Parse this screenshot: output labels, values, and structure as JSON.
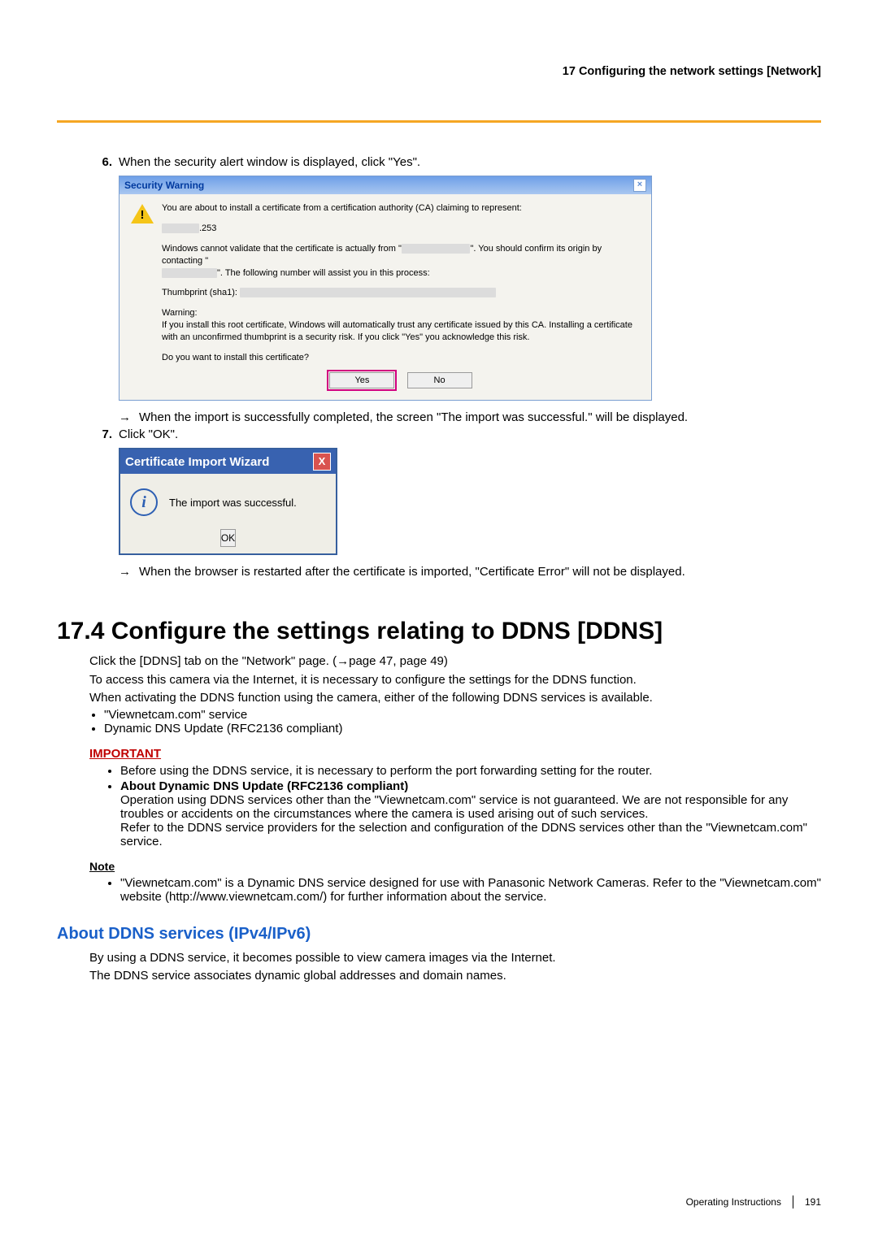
{
  "header": {
    "title": "17 Configuring the network settings [Network]"
  },
  "step6": {
    "num": "6.",
    "text": "When the security alert window is displayed, click \"Yes\"."
  },
  "security_dialog": {
    "title": "Security Warning",
    "line1": "You are about to install a certificate from a certification authority (CA) claiming to represent:",
    "masked1": ".253",
    "line2a": "Windows cannot validate that the certificate is actually from \"",
    "line2b": "\". You should confirm its origin by contacting \"",
    "line2c": "\". The following number will assist you in this process:",
    "thumb_label": "Thumbprint (sha1): ",
    "warning_label": "Warning:",
    "warning_text": "If you install this root certificate, Windows will automatically trust any certificate issued by this CA. Installing a certificate with an unconfirmed thumbprint is a security risk. If you click \"Yes\" you acknowledge this risk.",
    "question": "Do you want to install this certificate?",
    "yes": "Yes",
    "no": "No"
  },
  "arrow1": "When the import is successfully completed, the screen \"The import was successful.\" will be displayed.",
  "step7": {
    "num": "7.",
    "text": "Click \"OK\"."
  },
  "import_dialog": {
    "title": "Certificate Import Wizard",
    "message": "The import was successful.",
    "ok": "OK"
  },
  "arrow2": "When the browser is restarted after the certificate is imported, \"Certificate Error\" will not be displayed.",
  "section": {
    "heading": "17.4  Configure the settings relating to DDNS [DDNS]",
    "p1": "Click the [DDNS] tab on the \"Network\" page. (→page 47, page 49)",
    "p2": "To access this camera via the Internet, it is necessary to configure the settings for the DDNS function.",
    "p3": "When activating the DDNS function using the camera, either of the following DDNS services is available.",
    "bullets": [
      "\"Viewnetcam.com\" service",
      "Dynamic DNS Update (RFC2136 compliant)"
    ]
  },
  "important": {
    "label": "IMPORTANT",
    "b1": "Before using the DDNS service, it is necessary to perform the port forwarding setting for the router.",
    "b2_title": "About Dynamic DNS Update (RFC2136 compliant)",
    "b2_p1": "Operation using DDNS services other than the \"Viewnetcam.com\" service is not guaranteed. We are not responsible for any troubles or accidents on the circumstances where the camera is used arising out of such services.",
    "b2_p2": "Refer to the DDNS service providers for the selection and configuration of the DDNS services other than the \"Viewnetcam.com\" service."
  },
  "note": {
    "label": "Note",
    "text": "\"Viewnetcam.com\" is a Dynamic DNS service designed for use with Panasonic Network Cameras. Refer to the \"Viewnetcam.com\" website (http://www.viewnetcam.com/) for further information about the service."
  },
  "subsection": {
    "heading": "About DDNS services (IPv4/IPv6)",
    "p1": "By using a DDNS service, it becomes possible to view camera images via the Internet.",
    "p2": "The DDNS service associates dynamic global addresses and domain names."
  },
  "footer": {
    "label": "Operating Instructions",
    "page": "191"
  }
}
